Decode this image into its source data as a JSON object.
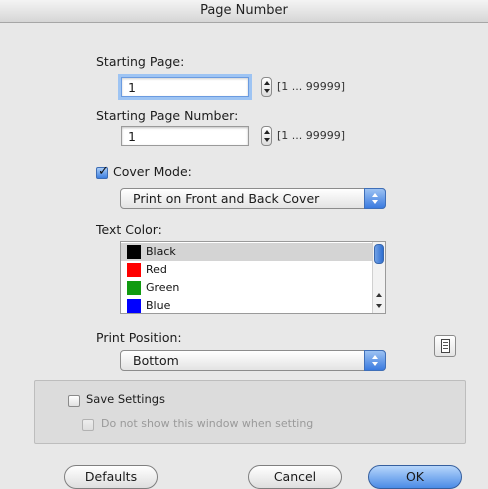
{
  "dialog": {
    "title": "Page Number"
  },
  "starting_page": {
    "label": "Starting Page:",
    "value": "1",
    "range": "[1 ... 99999]"
  },
  "starting_page_number": {
    "label": "Starting Page Number:",
    "value": "1",
    "range": "[1 ... 99999]"
  },
  "cover_mode": {
    "label": "Cover Mode:",
    "checked": true,
    "selected": "Print on Front and Back Cover"
  },
  "text_color": {
    "label": "Text Color:",
    "options": [
      {
        "name": "Black",
        "swatch": "#000000",
        "selected": true
      },
      {
        "name": "Red",
        "swatch": "#ff0000"
      },
      {
        "name": "Green",
        "swatch": "#109a10"
      },
      {
        "name": "Blue",
        "swatch": "#0000ff"
      }
    ]
  },
  "print_position": {
    "label": "Print Position:",
    "selected": "Bottom",
    "icon": "page-position-icon"
  },
  "save_settings": {
    "label": "Save Settings",
    "checked": false,
    "suboption": "Do not show this window when setting",
    "suboption_enabled": false
  },
  "buttons": {
    "defaults": "Defaults",
    "cancel": "Cancel",
    "ok": "OK"
  },
  "colors": {
    "accent": "#3a7ae0",
    "focus_ring": "#9ec4f3",
    "background": "#e8e8e8"
  }
}
